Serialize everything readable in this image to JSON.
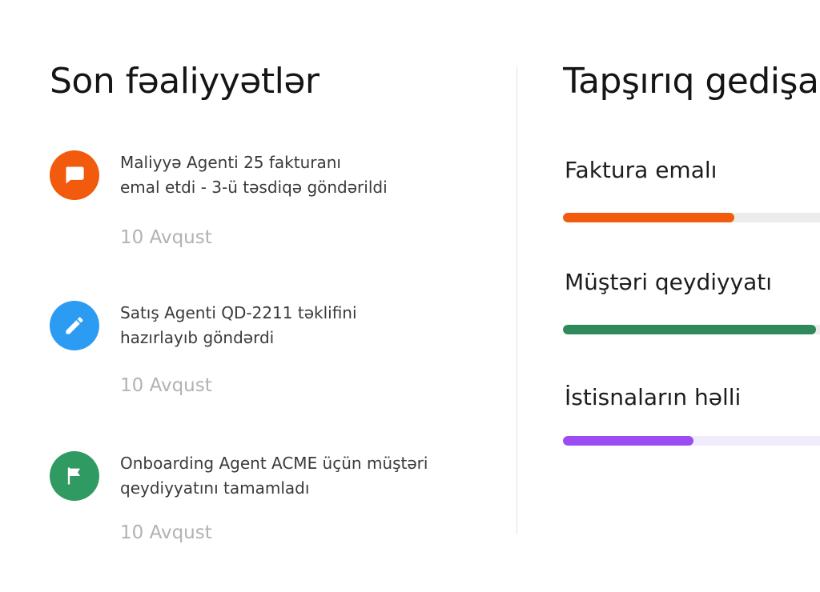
{
  "activity_panel": {
    "title": "Son fəaliyyətlər",
    "items": [
      {
        "icon": "chat-bubble-icon",
        "color": "#f25a0d",
        "line1": "Maliyyə Agenti 25 fakturanı",
        "line2": "emal etdi -  3-ü təsdiqə göndərildi",
        "date": "10 Avqust"
      },
      {
        "icon": "pencil-icon",
        "color": "#2c9cf2",
        "line1": "Satış Agenti QD-2211 təklifini",
        "line2": "hazırlayıb göndərdi",
        "date": "10 Avqust"
      },
      {
        "icon": "flag-icon",
        "color": "#2f9a61",
        "line1": "Onboarding Agent ACME üçün müştəri",
        "line2": "qeydiyyatını tamamladı",
        "date": "10 Avqust"
      }
    ]
  },
  "progress_panel": {
    "title": "Tapşırıq gedişa",
    "tasks": [
      {
        "label": "Faktura emalı",
        "progress": 0.63,
        "fill_color": "#f25a0d",
        "track_color": "#ececec"
      },
      {
        "label": "Müştəri qeydiyyatı",
        "progress": 0.93,
        "fill_color": "#2e8a5b",
        "track_color": "#ececec"
      },
      {
        "label": "İstisnaların həlli",
        "progress": 0.48,
        "fill_color": "#9b4df2",
        "track_color": "#f1ecfb"
      }
    ]
  }
}
